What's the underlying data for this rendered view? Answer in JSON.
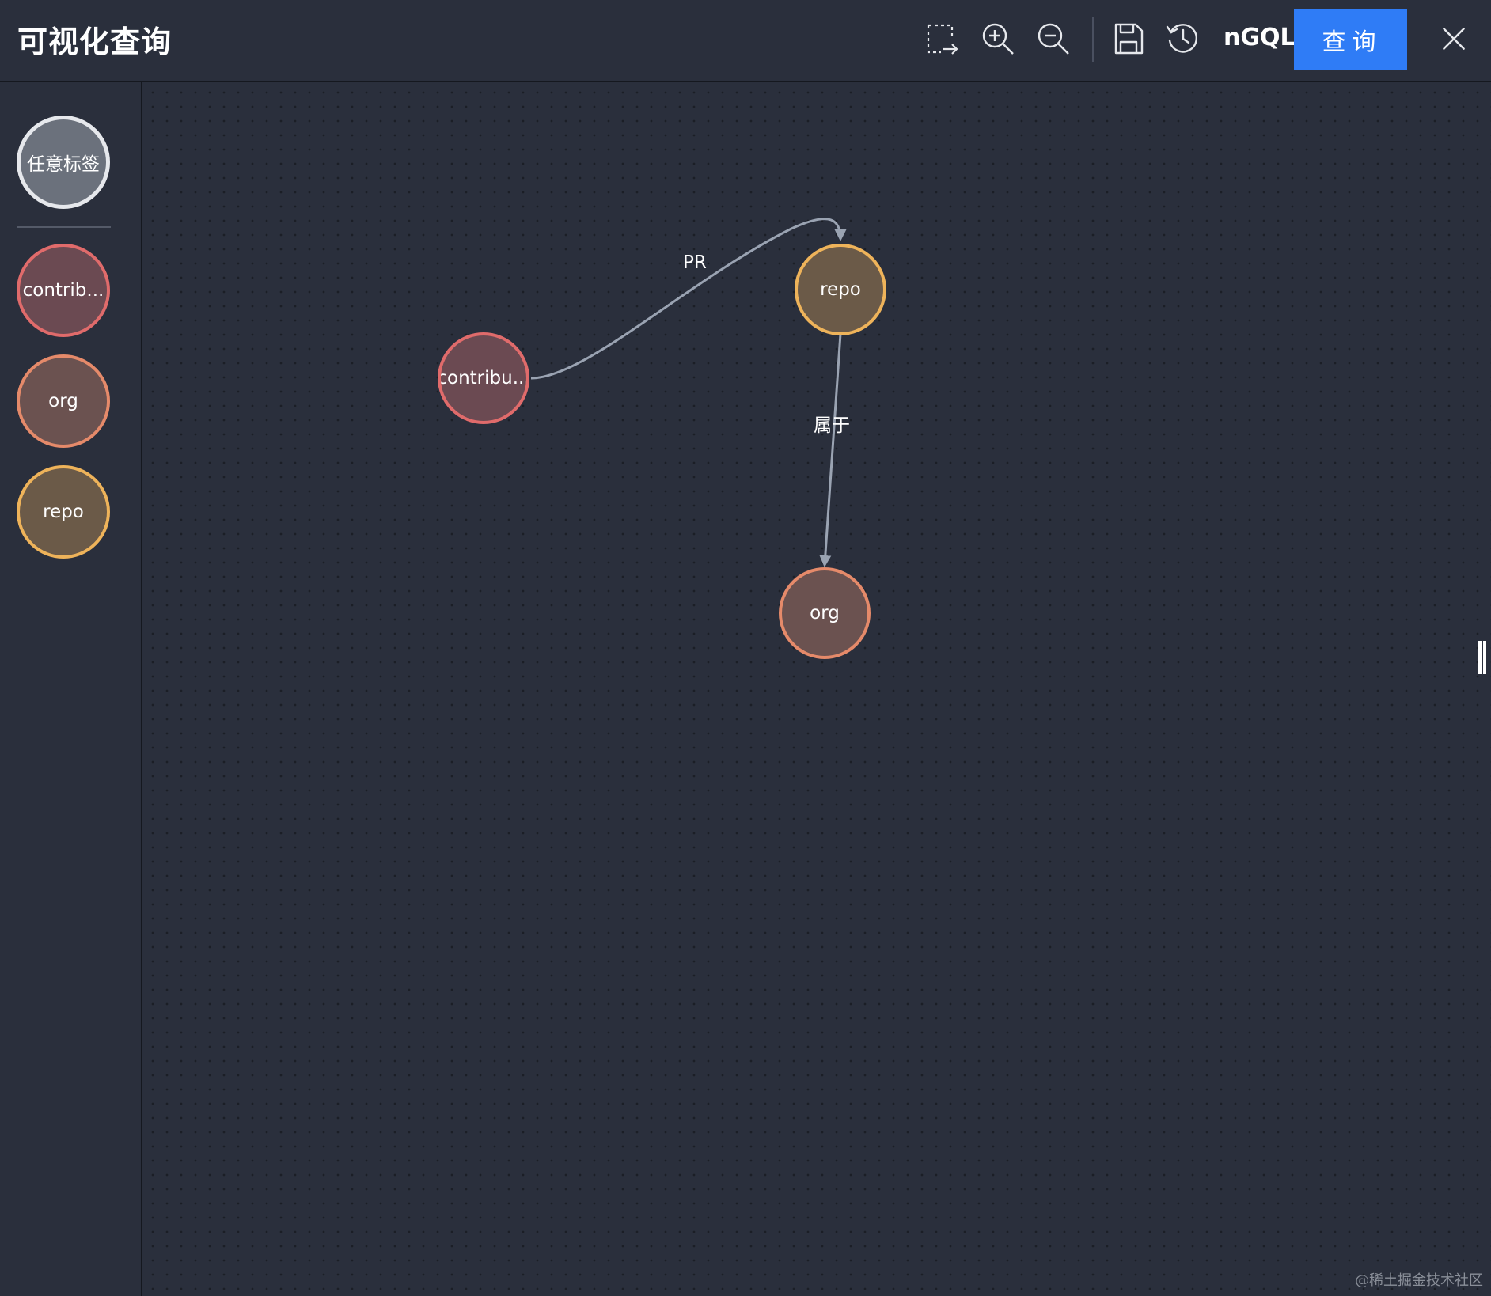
{
  "header": {
    "title": "可视化查询",
    "toolbar": {
      "select_icon": "dashed-select-icon",
      "zoom_in_icon": "zoom-in-icon",
      "zoom_out_icon": "zoom-out-icon",
      "save_icon": "save-icon",
      "history_icon": "history-icon",
      "ngql_label": "nGQL",
      "query_label": "查询",
      "close_icon": "close-icon"
    },
    "accent_color": "#2f7cf6"
  },
  "sidebar": {
    "any_tag": {
      "label": "任意标签",
      "fill": "#6b717c",
      "border": "#e6e8ec"
    },
    "tags": [
      {
        "label": "contrib...",
        "fill": "#6b4a52",
        "border": "#e06b6b"
      },
      {
        "label": "org",
        "fill": "#6b5250",
        "border": "#e58a6a"
      },
      {
        "label": "repo",
        "fill": "#6b5a48",
        "border": "#eeb35a"
      }
    ]
  },
  "canvas": {
    "nodes": [
      {
        "id": "contributor",
        "label": "contribu...",
        "fill": "#6b4a52",
        "border": "#e06b6b"
      },
      {
        "id": "repo",
        "label": "repo",
        "fill": "#6b5a48",
        "border": "#eeb35a"
      },
      {
        "id": "org",
        "label": "org",
        "fill": "#6b5250",
        "border": "#e58a6a"
      }
    ],
    "edges": [
      {
        "label": "PR",
        "from": "contributor",
        "to": "repo"
      },
      {
        "label": "属于",
        "from": "repo",
        "to": "org"
      }
    ],
    "edge_color": "#9aa3b2"
  },
  "watermark": "@稀土掘金技术社区"
}
